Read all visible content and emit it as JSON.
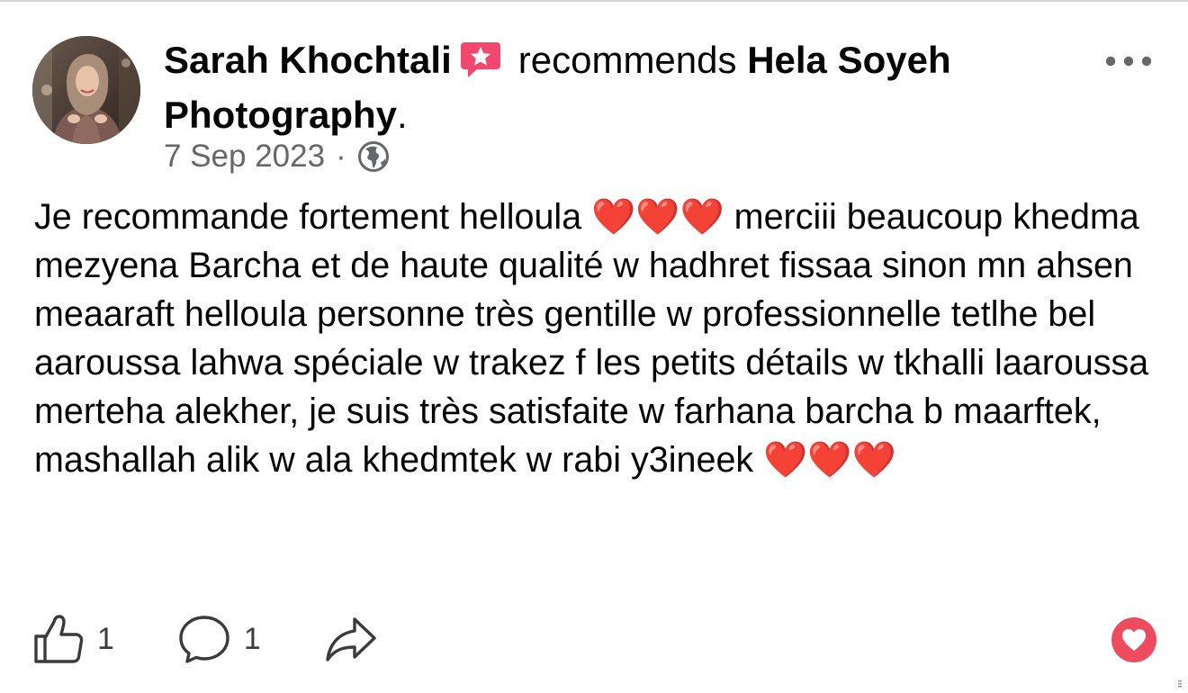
{
  "post": {
    "author_name": "Sarah Khochtali",
    "recommends_text": "recommends",
    "page_name": "Hela Soyeh Photography",
    "period": ".",
    "date": "7 Sep 2023",
    "separator": "·",
    "privacy_icon": "globe-icon",
    "author_badge_icon": "star-message-badge-icon",
    "menu_icon": "more-options-icon",
    "body_text": "Je recommande fortement helloula ❤️❤️❤️ merciii beaucoup khedma mezyena Barcha et de haute qualité w hadhret fissaa sinon mn ahsen meaaraft helloula personne très gentille w professionnelle tetlhe bel aaroussa lahwa spéciale w trakez f les petits détails w tkhalli laaroussa merteha alekher, je suis très satisfaite w farhana barcha b maarftek, mashallah alik w ala khedmtek w rabi y3ineek ❤️❤️❤️"
  },
  "actions": {
    "like_icon": "thumbs-up-icon",
    "like_count": "1",
    "comment_icon": "comment-bubble-icon",
    "comment_count": "1",
    "share_icon": "share-arrow-icon",
    "reaction_icon": "heart-reaction-icon"
  },
  "colors": {
    "text_primary": "#050505",
    "text_secondary": "#65676b",
    "badge_pink": "#f2486f",
    "heart_red": "#ef4b5e"
  }
}
